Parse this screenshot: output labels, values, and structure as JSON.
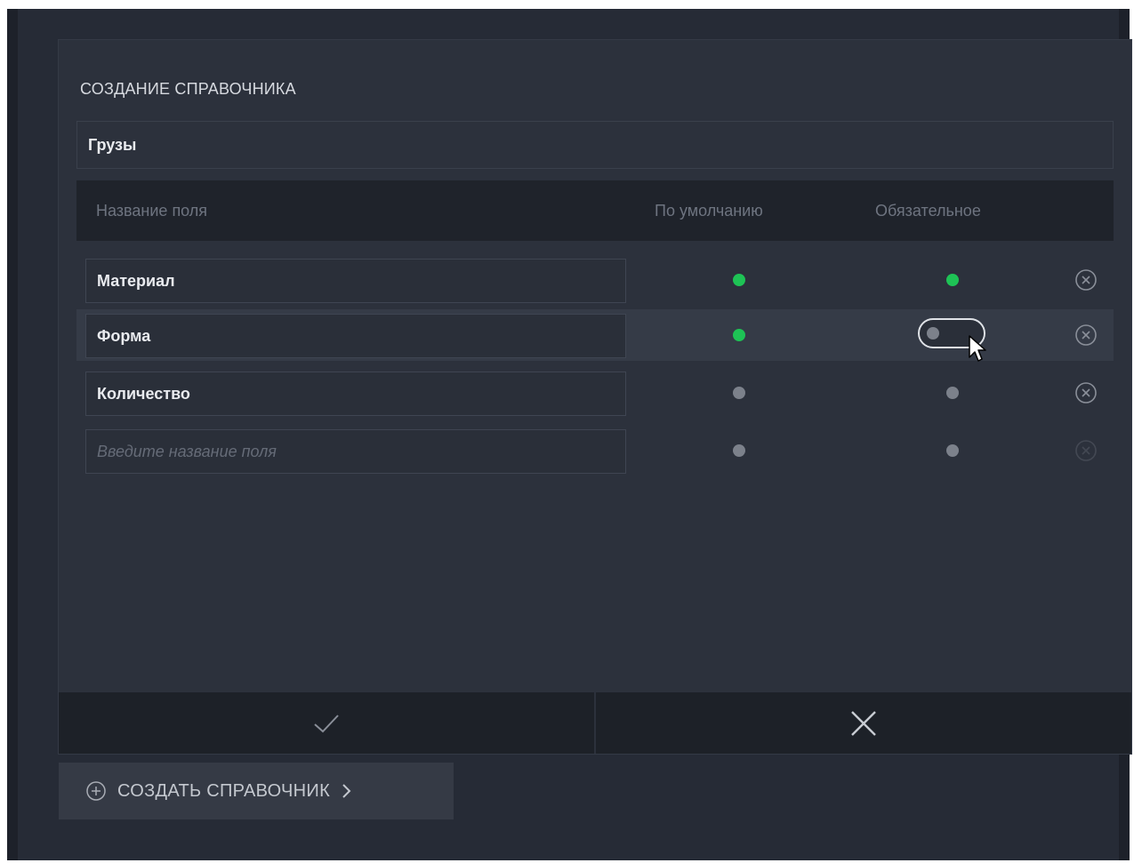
{
  "dialog": {
    "title": "СОЗДАНИЕ СПРАВОЧНИКА",
    "name_value": "Грузы"
  },
  "table": {
    "headers": {
      "name": "Название поля",
      "default": "По умолчанию",
      "required": "Обязательное"
    },
    "rows": [
      {
        "name": "Материал",
        "default": true,
        "required": true
      },
      {
        "name": "Форма",
        "default": true,
        "required": false
      },
      {
        "name": "Количество",
        "default": false,
        "required": false
      }
    ],
    "new_row": {
      "placeholder": "Введите название поля",
      "default": false,
      "required": false
    }
  },
  "icons": {
    "confirm": "checkmark-icon",
    "cancel": "close-icon",
    "remove": "remove-circle-icon",
    "add": "plus-circle-icon",
    "chevron": "chevron-right-icon",
    "cursor": "mouse-pointer-icon"
  },
  "create_button": {
    "label": "СОЗДАТЬ СПРАВОЧНИК"
  },
  "colors": {
    "active_dot": "#1ec355",
    "inactive_dot": "#7c818b",
    "background": "#2c313c"
  }
}
